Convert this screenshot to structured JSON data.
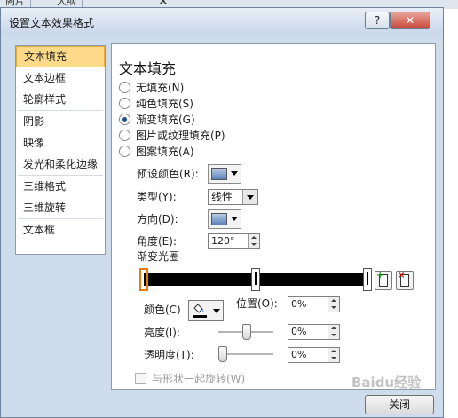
{
  "background_tabs": {
    "tab1": "阁片",
    "tab2": "大纲",
    "close_glyph": "✕"
  },
  "dialog": {
    "title": "设置文本效果格式",
    "help_glyph": "?",
    "close_glyph": "✕",
    "close_button": "关闭"
  },
  "nav": {
    "items": [
      "文本填充",
      "文本边框",
      "轮廓样式",
      "阴影",
      "映像",
      "发光和柔化边缘",
      "三维格式",
      "三维旋转",
      "文本框"
    ],
    "active_index": 0
  },
  "fill": {
    "section_title": "文本填充",
    "options": [
      "无填充(N)",
      "纯色填充(S)",
      "渐变填充(G)",
      "图片或纹理填充(P)",
      "图案填充(A)"
    ],
    "selected_index": 2,
    "preset_label": "预设颜色(R):",
    "type_label": "类型(Y):",
    "type_value": "线性",
    "direction_label": "方向(D):",
    "angle_label": "角度(E):",
    "angle_value": "120°",
    "gradient_stops_label": "渐变光圈",
    "color_label": "颜色(C)",
    "position_label": "位置(O):",
    "position_value": "0%",
    "brightness_label": "亮度(I):",
    "brightness_value": "0%",
    "brightness_level": 0.5,
    "transparency_label": "透明度(T):",
    "transparency_value": "0%",
    "transparency_level": 0,
    "rotate_label": "与形状一起旋转(W)"
  },
  "gradient_stops": [
    0,
    50,
    100
  ],
  "colors": {
    "accent_orange": "#e07b1a",
    "nav_active": "#fdd98a",
    "dialog_bg": "#cfdcec"
  },
  "icons": {
    "add_stop": "add-gradient-stop-icon",
    "remove_stop": "remove-gradient-stop-icon",
    "fill_color": "paint-bucket-icon"
  },
  "watermark": "Baidu经验"
}
